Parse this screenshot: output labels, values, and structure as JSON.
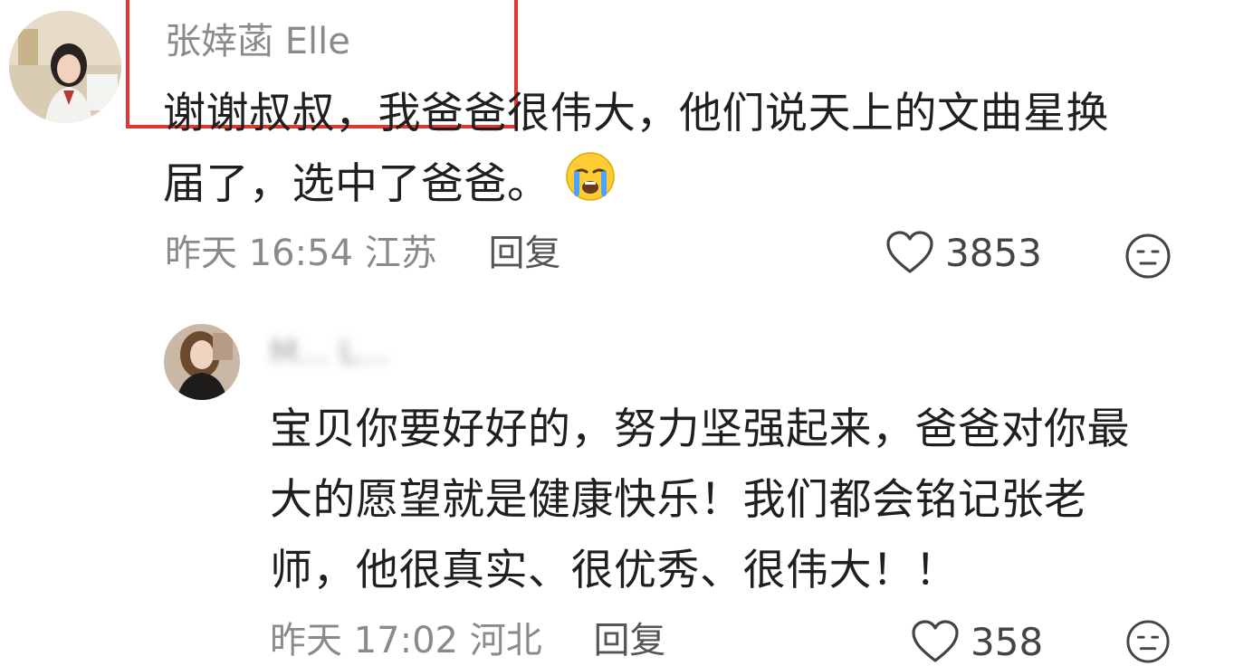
{
  "comment1": {
    "username": "张婞菡 Elle",
    "text_line1": "谢谢叔叔，我爸爸很伟大，他们说天上的文曲星换",
    "text_line2": "届了，选中了爸爸。",
    "emoji": "loudly-crying-face-emoji",
    "time": "昨天 16:54",
    "location": "江苏",
    "reply_label": "回复",
    "likes": "3853"
  },
  "reply1": {
    "username": "M... L...",
    "text_line1": "宝贝你要好好的，努力坚强起来，爸爸对你最",
    "text_line2": "大的愿望就是健康快乐！我们都会铭记张老",
    "text_line3": "师，他很真实、很优秀、很伟大！！",
    "time": "昨天 17:02",
    "location": "河北",
    "reply_label": "回复",
    "likes": "358"
  },
  "icons": {
    "like": "heart-outline-icon",
    "dislike": "neutral-face-icon"
  },
  "colors": {
    "highlight_border": "#e0372f",
    "meta_text": "#8a8a8a",
    "body_text": "#1f1f1f"
  }
}
